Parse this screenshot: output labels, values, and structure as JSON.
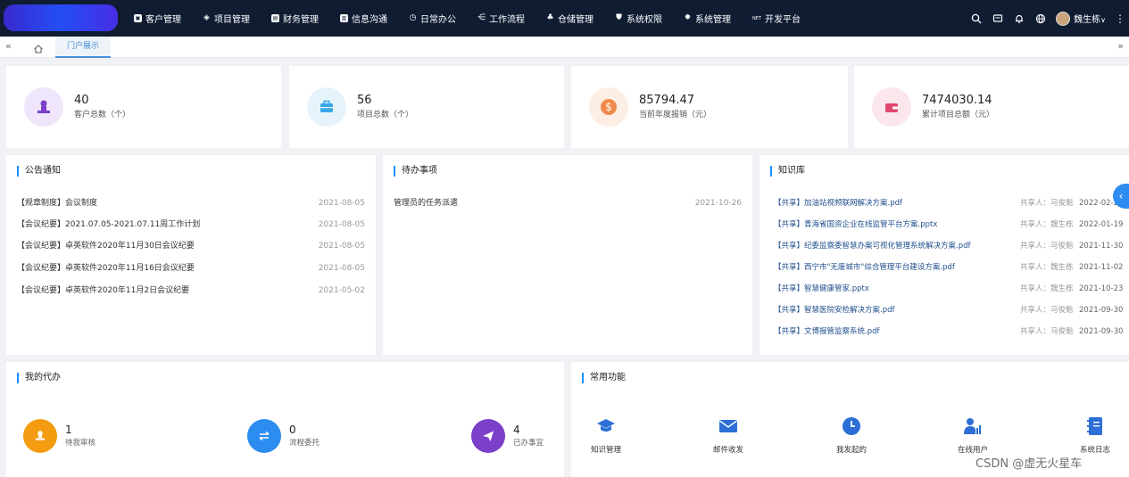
{
  "nav": {
    "menu": [
      {
        "label": "客户管理",
        "icon": "customer-icon"
      },
      {
        "label": "项目管理",
        "icon": "project-icon"
      },
      {
        "label": "财务管理",
        "icon": "finance-icon"
      },
      {
        "label": "信息沟通",
        "icon": "message-icon"
      },
      {
        "label": "日常办公",
        "icon": "clock-icon"
      },
      {
        "label": "工作流程",
        "icon": "flow-icon"
      },
      {
        "label": "仓储管理",
        "icon": "warehouse-icon"
      },
      {
        "label": "系统权限",
        "icon": "shield-icon"
      },
      {
        "label": "系统管理",
        "icon": "gear-icon"
      },
      {
        "label": "开发平台",
        "icon": "net-icon",
        "prefix": "NET"
      }
    ],
    "user": "魏生栋",
    "user_caret": "∨",
    "more": "⋮"
  },
  "tabs": {
    "left_arrow": "«",
    "right_arrow": "»",
    "active_tab": "门户展示"
  },
  "stats": [
    {
      "value": "40",
      "label": "客户总数（个）",
      "color": "#7b3fc9",
      "bg": "#efe6fb"
    },
    {
      "value": "56",
      "label": "项目总数（个）",
      "color": "#3aa7e8",
      "bg": "#e6f3fb"
    },
    {
      "value": "85794.47",
      "label": "当前年度报销（元）",
      "color": "#f08a4b",
      "bg": "#fdeee3"
    },
    {
      "value": "7474030.14",
      "label": "累计项目总额（元）",
      "color": "#e0466d",
      "bg": "#fbe6ec"
    }
  ],
  "notice": {
    "title": "公告通知",
    "items": [
      {
        "text": "【规章制度】会议制度",
        "date": "2021-08-05"
      },
      {
        "text": "【会议纪要】2021.07.05-2021.07.11周工作计划",
        "date": "2021-08-05"
      },
      {
        "text": "【会议纪要】卓英软件2020年11月30日会议纪要",
        "date": "2021-08-05"
      },
      {
        "text": "【会议纪要】卓英软件2020年11月16日会议纪要",
        "date": "2021-08-05"
      },
      {
        "text": "【会议纪要】卓英软件2020年11月2日会议纪要",
        "date": "2021-05-02"
      }
    ]
  },
  "todo_list": {
    "title": "待办事项",
    "items": [
      {
        "text": "管理员的任务派遣",
        "date": "2021-10-26"
      }
    ]
  },
  "knowledge": {
    "title": "知识库",
    "items": [
      {
        "text": "【共享】加油站视频联网解决方案.pdf",
        "sharer": "共享人：马俊魁",
        "date": "2022-02-23"
      },
      {
        "text": "【共享】青海省国资企业在线监管平台方案.pptx",
        "sharer": "共享人：魏生栋",
        "date": "2022-01-19"
      },
      {
        "text": "【共享】纪委监察委智慧办案可视化管理系统解决方案.pdf",
        "sharer": "共享人：马俊魁",
        "date": "2021-11-30"
      },
      {
        "text": "【共享】西宁市\"无废城市\"综合管理平台建设方案.pdf",
        "sharer": "共享人：魏生栋",
        "date": "2021-11-02"
      },
      {
        "text": "【共享】智慧健康管家.pptx",
        "sharer": "共享人：魏生栋",
        "date": "2021-10-23"
      },
      {
        "text": "【共享】智慧医院安检解决方案.pdf",
        "sharer": "共享人：马俊魁",
        "date": "2021-09-30"
      },
      {
        "text": "【共享】文博报管监察系统.pdf",
        "sharer": "共享人：马俊魁",
        "date": "2021-09-30"
      }
    ]
  },
  "my_tasks": {
    "title": "我的代办",
    "items": [
      {
        "value": "1",
        "label": "待我审核",
        "color": "#f39c12"
      },
      {
        "value": "0",
        "label": "流程委托",
        "color": "#2d8cf0"
      },
      {
        "value": "4",
        "label": "已办事宜",
        "color": "#7b3fc9"
      }
    ]
  },
  "functions": {
    "title": "常用功能",
    "items": [
      {
        "label": "知识管理",
        "icon": "graduation-cap-icon"
      },
      {
        "label": "邮件收发",
        "icon": "mail-icon"
      },
      {
        "label": "我发起的",
        "icon": "clock-icon"
      },
      {
        "label": "在线用户",
        "icon": "user-chart-icon"
      },
      {
        "label": "系统日志",
        "icon": "log-book-icon"
      }
    ]
  },
  "side_toggle": "‹",
  "watermark": "CSDN @虚无火星车",
  "colors": {
    "accent": "#1890ff",
    "topbar": "#0f1c32"
  }
}
